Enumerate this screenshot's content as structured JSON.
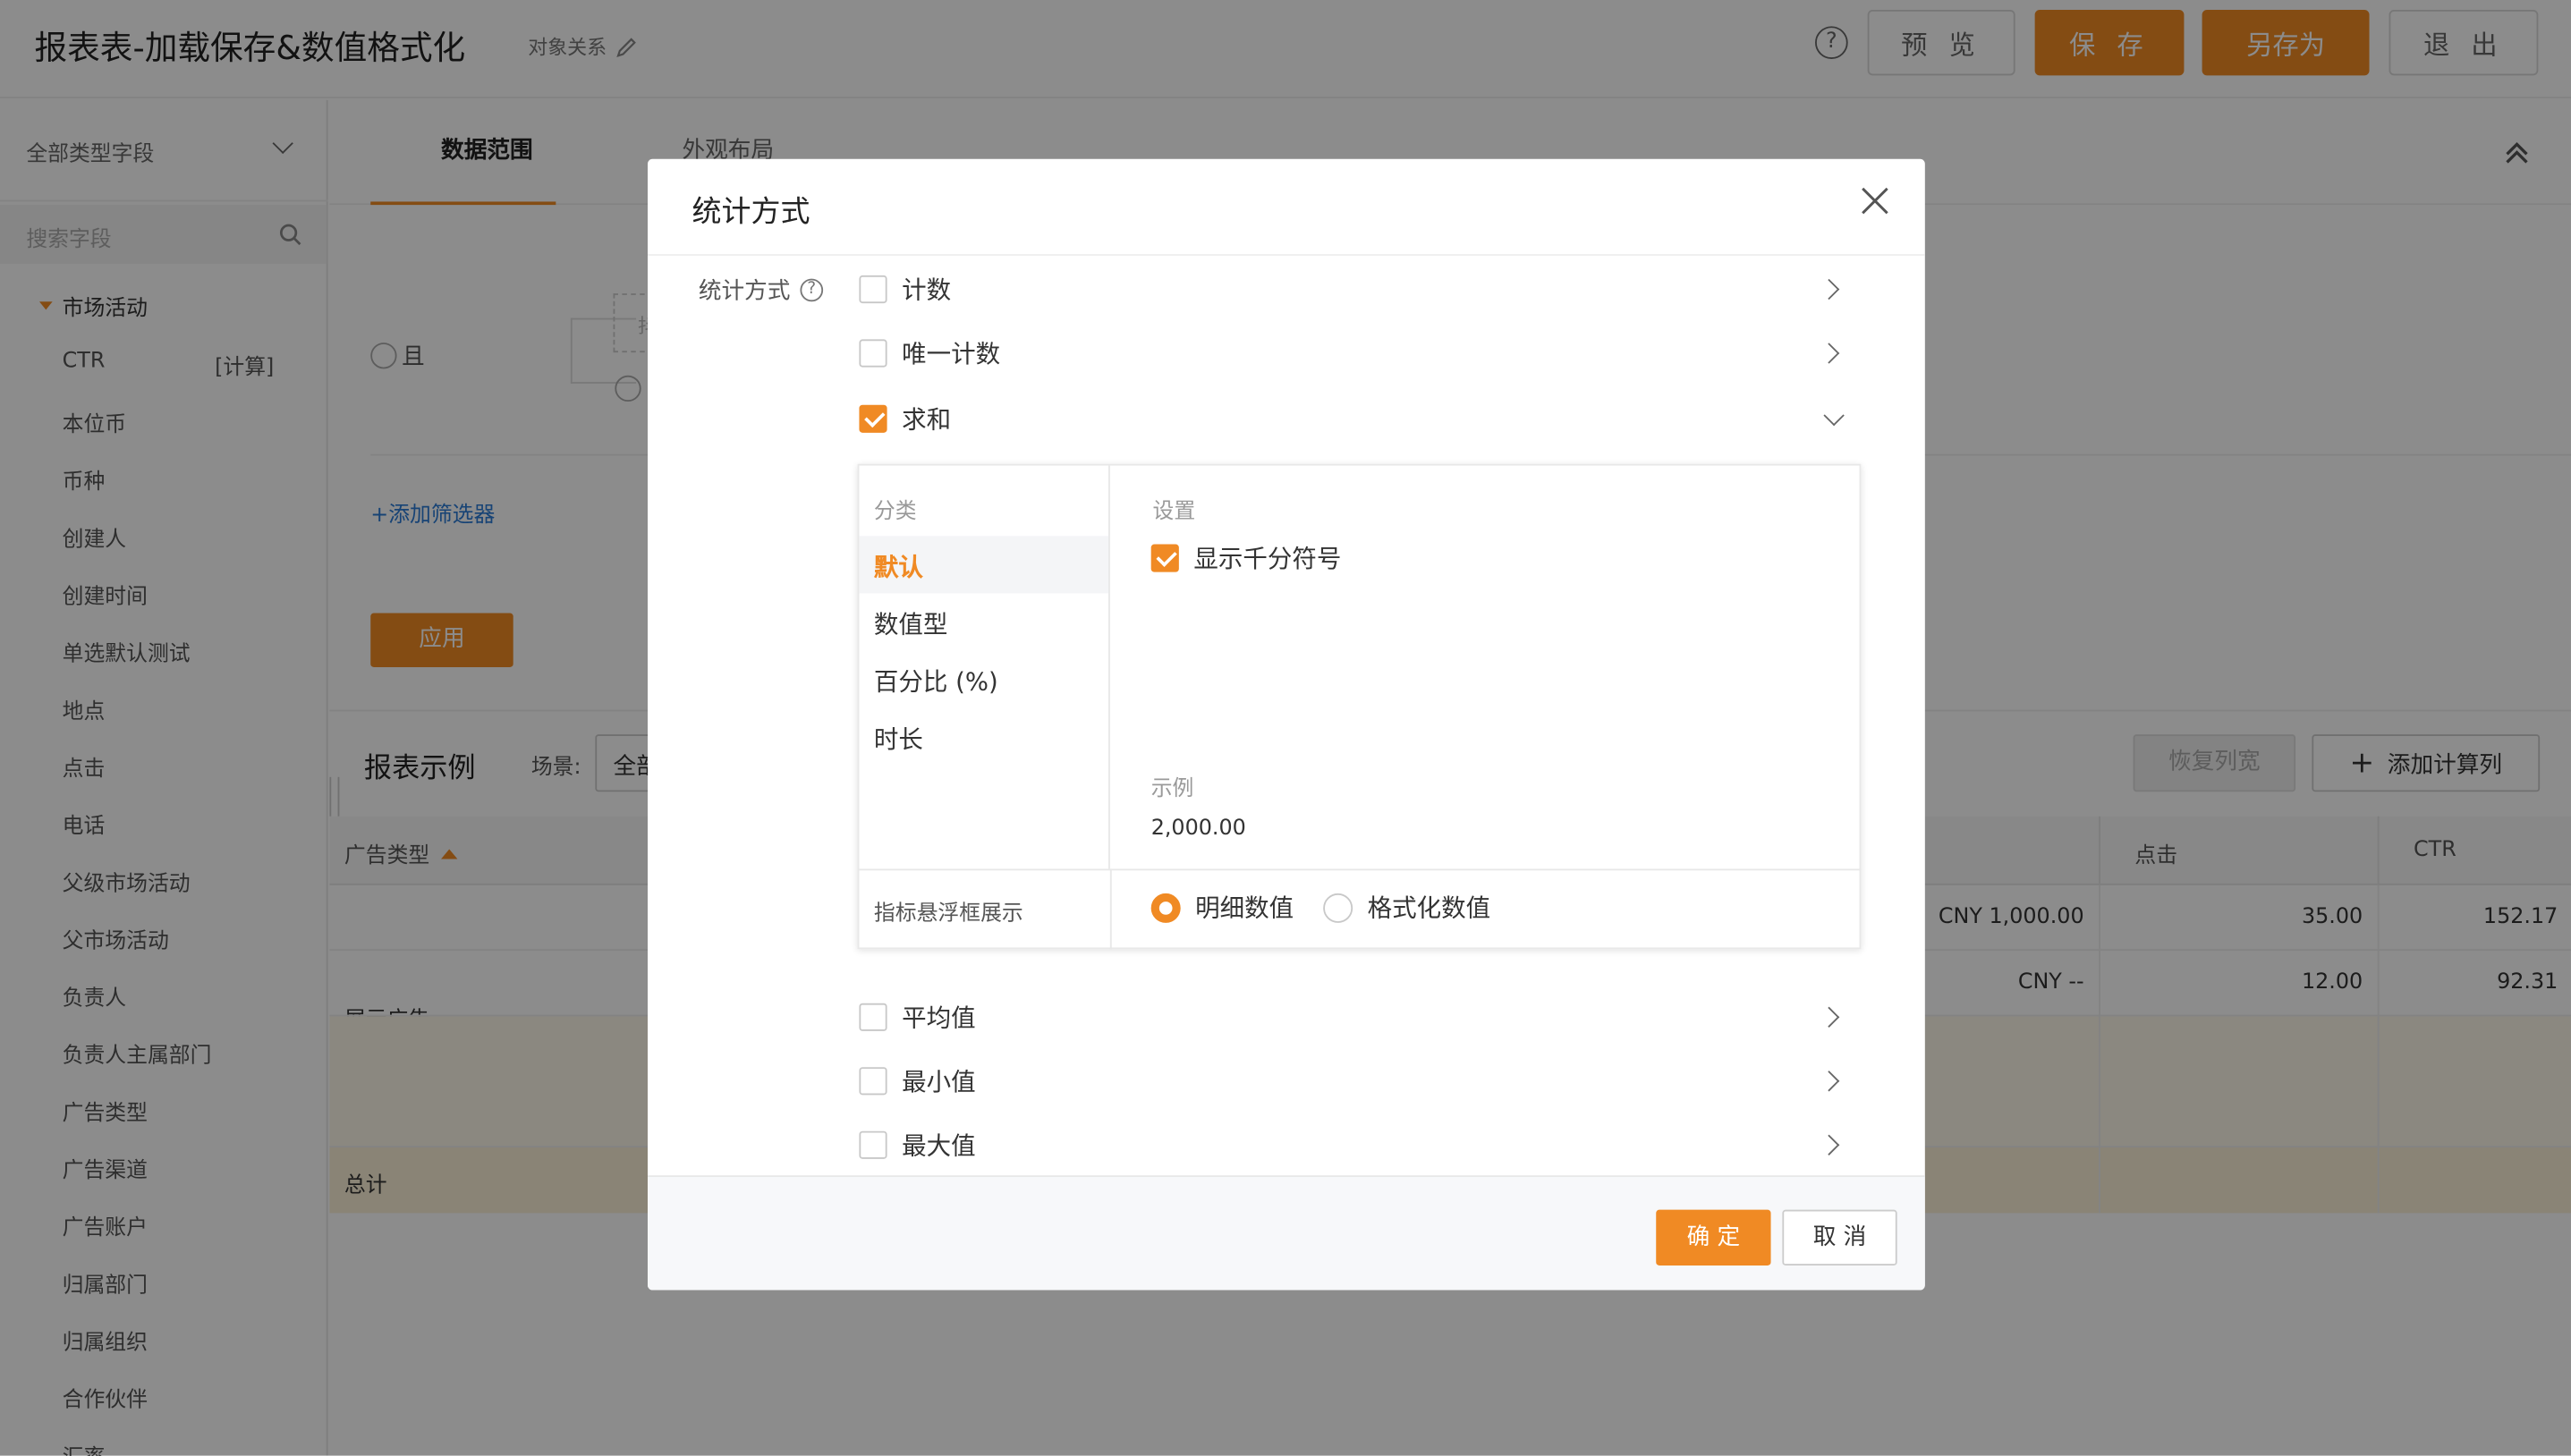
{
  "header": {
    "title": "报表表-加载保存&数值格式化",
    "relation_link": "对象关系",
    "buttons": {
      "preview": "预 览",
      "save": "保 存",
      "save_as": "另存为",
      "exit": "退 出"
    }
  },
  "sidebar": {
    "field_type_select": "全部类型字段",
    "search_placeholder": "搜索字段",
    "group": "市场活动",
    "items": [
      {
        "label": "CTR",
        "tag": "[计算]"
      },
      {
        "label": "本位币"
      },
      {
        "label": "币种"
      },
      {
        "label": "创建人"
      },
      {
        "label": "创建时间"
      },
      {
        "label": "单选默认测试"
      },
      {
        "label": "地点"
      },
      {
        "label": "点击"
      },
      {
        "label": "电话"
      },
      {
        "label": "父级市场活动"
      },
      {
        "label": "父市场活动"
      },
      {
        "label": "负责人"
      },
      {
        "label": "负责人主属部门"
      },
      {
        "label": "广告类型"
      },
      {
        "label": "广告渠道"
      },
      {
        "label": "广告账户"
      },
      {
        "label": "归属部门"
      },
      {
        "label": "归属组织"
      },
      {
        "label": "合作伙伴"
      },
      {
        "label": "汇率"
      }
    ]
  },
  "main": {
    "tabs": [
      {
        "label": "数据范围",
        "active": true
      },
      {
        "label": "外观布局",
        "active": false
      }
    ],
    "filter": {
      "logic": "且",
      "add_filter": "+添加筛选器",
      "apply": "应用",
      "placeholder_char": "抖"
    },
    "report": {
      "title": "报表示例",
      "scene_label": "场景:",
      "scene_value": "全部",
      "restore_width": "恢复列宽",
      "add_calc_column": "添加计算列",
      "columns": [
        "广告类型",
        "点击",
        "CTR"
      ],
      "group_label": "展示广告",
      "rows": [
        {
          "amount": "CNY 1,000.00",
          "clicks": "35.00",
          "ctr": "152.17"
        },
        {
          "amount": "CNY --",
          "clicks": "12.00",
          "ctr": "92.31"
        }
      ],
      "total_label": "总计"
    }
  },
  "modal": {
    "title": "统计方式",
    "field_label": "统计方式",
    "options_top": [
      {
        "label": "计数",
        "checked": false
      },
      {
        "label": "唯一计数",
        "checked": false
      },
      {
        "label": "求和",
        "checked": true
      }
    ],
    "format_panel": {
      "category_header": "分类",
      "categories": [
        {
          "label": "默认",
          "active": true
        },
        {
          "label": "数值型",
          "active": false
        },
        {
          "label": "百分比 (%)",
          "active": false
        },
        {
          "label": "时长",
          "active": false
        }
      ],
      "settings_header": "设置",
      "thousand_sep_label": "显示千分符号",
      "thousand_sep_checked": true,
      "example_label": "示例",
      "example_value": "2,000.00",
      "tooltip_label": "指标悬浮框展示",
      "tooltip_options": [
        {
          "label": "明细数值",
          "selected": true
        },
        {
          "label": "格式化数值",
          "selected": false
        }
      ]
    },
    "options_bottom": [
      {
        "label": "平均值",
        "checked": false
      },
      {
        "label": "最小值",
        "checked": false
      },
      {
        "label": "最大值",
        "checked": false
      }
    ],
    "confirm": "确 定",
    "cancel": "取 消"
  },
  "colors": {
    "accent": "#f08a24",
    "overlay": "rgba(0,0,0,0.45)",
    "link": "#2b7bd6"
  }
}
